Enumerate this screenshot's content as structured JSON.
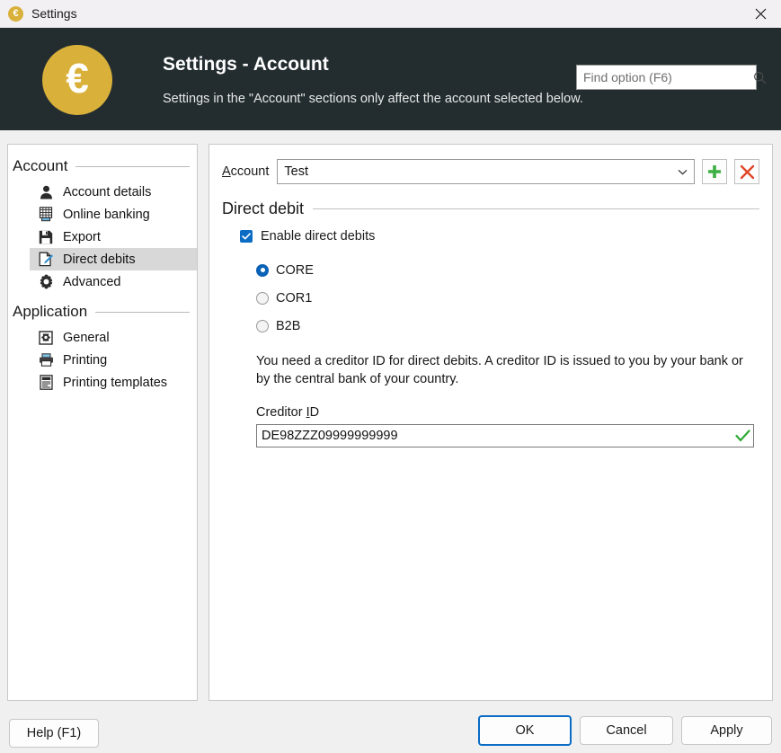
{
  "window": {
    "title": "Settings",
    "app_icon": "euro-coin-icon",
    "close_icon": "close-icon"
  },
  "header": {
    "logo_glyph": "€",
    "logo_name": "euro-logo",
    "title": "Settings - Account",
    "subtitle": "Settings in the \"Account\" sections only affect the account selected below.",
    "search": {
      "placeholder": "Find option (F6)",
      "value": "",
      "icon": "search-icon"
    }
  },
  "sidebar": {
    "groups": [
      {
        "label": "Account",
        "items": [
          {
            "label": "Account details",
            "icon": "user-icon",
            "selected": false
          },
          {
            "label": "Online banking",
            "icon": "calculator-icon",
            "selected": false
          },
          {
            "label": "Export",
            "icon": "save-floppy-icon",
            "selected": false
          },
          {
            "label": "Direct debits",
            "icon": "document-edit-icon",
            "selected": true
          },
          {
            "label": "Advanced",
            "icon": "gear-icon",
            "selected": false
          }
        ]
      },
      {
        "label": "Application",
        "items": [
          {
            "label": "General",
            "icon": "settings-box-icon",
            "selected": false
          },
          {
            "label": "Printing",
            "icon": "printer-icon",
            "selected": false
          },
          {
            "label": "Printing templates",
            "icon": "document-lines-icon",
            "selected": false
          }
        ]
      }
    ]
  },
  "content": {
    "account_row": {
      "label_prefix": "A",
      "label_rest": "ccount",
      "selected_account": "Test",
      "dropdown_icon": "chevron-down-icon",
      "add_button_icon": "plus-icon",
      "delete_button_icon": "cross-icon"
    },
    "section": {
      "title": "Direct debit",
      "enable_checkbox": {
        "label": "Enable direct debits",
        "checked": true
      },
      "scheme_options": [
        {
          "label": "CORE",
          "checked": true
        },
        {
          "label": "COR1",
          "checked": false
        },
        {
          "label": "B2B",
          "checked": false
        }
      ],
      "info_text": "You need a creditor ID for direct debits. A creditor ID is issued to you by your bank or by the central bank of your country.",
      "creditor_field": {
        "label_prefix": "Creditor ",
        "label_key": "I",
        "label_suffix": "D",
        "value": "DE98ZZZ09999999999",
        "valid_icon": "checkmark-icon"
      }
    }
  },
  "footer": {
    "help": "Help (F1)",
    "ok": "OK",
    "cancel": "Cancel",
    "apply": "Apply"
  },
  "colors": {
    "header_bg": "#232d30",
    "accent_gold": "#d9b13a",
    "accent_blue": "#0a6cc4",
    "add_green": "#3cb043",
    "delete_red": "#e04326",
    "valid_green": "#2eaa34",
    "selection_gray": "#d8d8d8"
  }
}
